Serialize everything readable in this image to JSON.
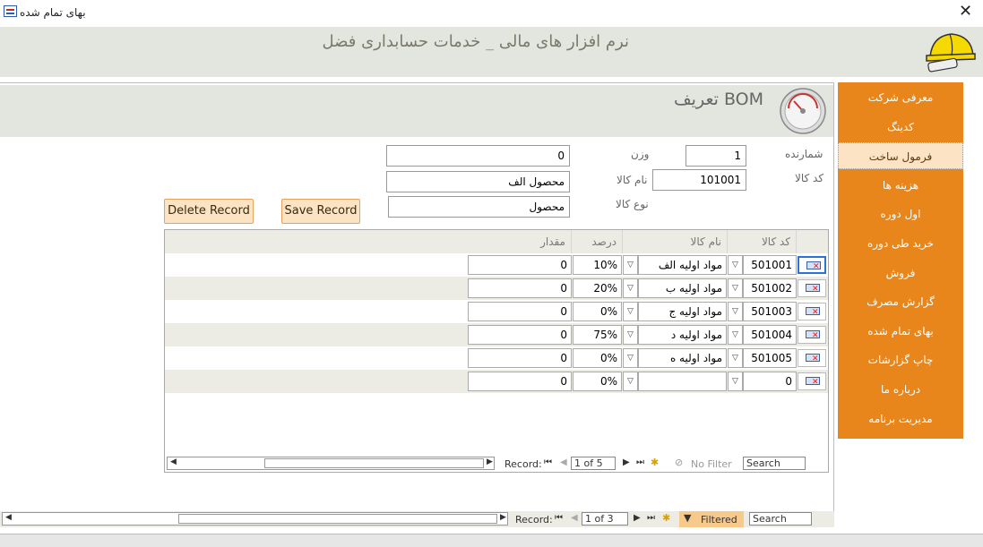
{
  "window": {
    "title": "بهای تمام شده",
    "close_label": "✕"
  },
  "header": {
    "app_title": "نرم افزار های مالی _ خدمات حسابداری فضل"
  },
  "sidebar": {
    "items": [
      {
        "label": "معرفی شرکت"
      },
      {
        "label": "کدینگ"
      },
      {
        "label": "فرمول ساخت"
      },
      {
        "label": "هزینه ها"
      },
      {
        "label": "اول دوره"
      },
      {
        "label": "خرید طی دوره"
      },
      {
        "label": "فروش"
      },
      {
        "label": "گزارش مصرف"
      },
      {
        "label": "بهای تمام شده"
      },
      {
        "label": "چاپ گزارشات"
      },
      {
        "label": "درباره ما"
      },
      {
        "label": "مدیریت برنامه"
      }
    ],
    "active_index": 2
  },
  "form": {
    "title": "تعریف BOM",
    "counter_label": "شمارنده",
    "counter_value": "1",
    "weight_label": "وزن",
    "weight_value": "0",
    "code_label": "کد کالا",
    "code_value": "101001",
    "name_label": "نام کالا",
    "name_value": "محصول الف",
    "type_label": "نوع کالا",
    "type_value": "محصول",
    "save_button": "Save Record",
    "delete_button": "Delete Record"
  },
  "grid": {
    "headers": {
      "code": "کد کالا",
      "name": "نام کالا",
      "percent": "درصد",
      "amount": "مقدار"
    },
    "rows": [
      {
        "code": "501001",
        "name": "مواد اولیه الف",
        "percent": "10%",
        "amount": "0"
      },
      {
        "code": "501002",
        "name": "مواد اولیه ب",
        "percent": "20%",
        "amount": "0"
      },
      {
        "code": "501003",
        "name": "مواد اولیه ج",
        "percent": "0%",
        "amount": "0"
      },
      {
        "code": "501004",
        "name": "مواد اولیه د",
        "percent": "75%",
        "amount": "0"
      },
      {
        "code": "501005",
        "name": "مواد اولیه ه",
        "percent": "0%",
        "amount": "0"
      },
      {
        "code": "0",
        "name": "",
        "percent": "0%",
        "amount": "0"
      }
    ],
    "nav": {
      "record_label": "Record:",
      "position": "1 of 5",
      "filter": "No Filter",
      "search": "Search"
    }
  },
  "main_nav": {
    "record_label": "Record:",
    "position": "1 of 3",
    "filter": "Filtered",
    "search": "Search"
  },
  "colors": {
    "accent": "#e8861c",
    "band": "#e3e6de",
    "button": "#fbe3c4"
  }
}
